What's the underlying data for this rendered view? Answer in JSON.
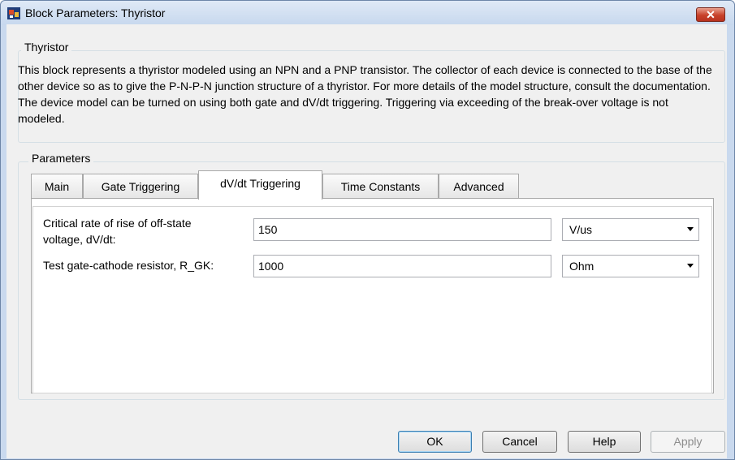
{
  "window": {
    "title": "Block Parameters: Thyristor",
    "close_glyph": "✕"
  },
  "block": {
    "group_label": "Thyristor",
    "description": "This block represents a thyristor modeled using an NPN and a PNP transistor. The collector of each device is connected to the base of the other device so as to give the P-N-P-N junction structure of a thyristor. For more details of the model structure, consult the documentation. The device model can be turned on using both gate and dV/dt triggering. Triggering via exceeding of the break-over voltage is not modeled."
  },
  "parameters": {
    "group_label": "Parameters",
    "tabs": [
      {
        "label": "Main",
        "active": false
      },
      {
        "label": "Gate Triggering",
        "active": false
      },
      {
        "label": "dV/dt Triggering",
        "active": true
      },
      {
        "label": "Time Constants",
        "active": false
      },
      {
        "label": "Advanced",
        "active": false
      }
    ],
    "fields": [
      {
        "label_line1": "Critical rate of rise of off-state",
        "label_line2": "voltage, dV/dt:",
        "value": "150",
        "unit": "V/us"
      },
      {
        "label": "Test gate-cathode resistor, R_GK:",
        "value": "1000",
        "unit": "Ohm"
      }
    ]
  },
  "buttons": {
    "ok": "OK",
    "cancel": "Cancel",
    "help": "Help",
    "apply": "Apply"
  },
  "icons": {
    "app": "simulink-block-icon",
    "close": "close-icon",
    "dropdown": "chevron-down-icon"
  },
  "colors": {
    "title_bar": "#c7d8ee",
    "client_bg": "#f0f0f0",
    "close_button": "#c8412a",
    "default_button_border": "#3c7fb1"
  }
}
